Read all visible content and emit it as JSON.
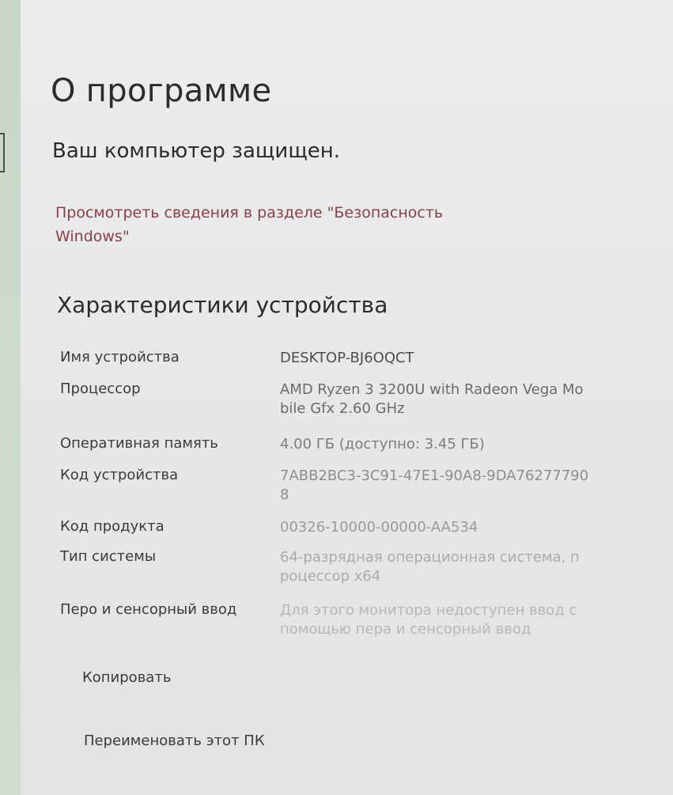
{
  "page": {
    "title": "О программе",
    "status": "Ваш компьютер защищен.",
    "security_link": "Просмотреть сведения в разделе \"Безопасность Windows\""
  },
  "device_specs": {
    "heading": "Характеристики устройства",
    "rows": [
      {
        "label": "Имя устройства",
        "value": "DESKTOP-BJ6OQCT"
      },
      {
        "label": "Процессор",
        "value": "AMD Ryzen 3 3200U with Radeon Vega Mobile Gfx     2.60 GHz"
      },
      {
        "label": "Оперативная память",
        "value": "4.00 ГБ (доступно: 3.45 ГБ)"
      },
      {
        "label": "Код устройства",
        "value": "7ABB2BC3-3C91-47E1-90A8-9DA76277790 8"
      },
      {
        "label": "Код продукта",
        "value": "00326-10000-00000-AA534"
      },
      {
        "label": "Тип системы",
        "value": "64-разрядная операционная система, процессор x64"
      },
      {
        "label": "Перо и сенсорный ввод",
        "value": "Для этого монитора недоступен ввод с помощью пера и сенсорный ввод"
      }
    ],
    "copy_label": "Копировать",
    "rename_label": "Переименовать этот ПК"
  },
  "colors": {
    "link": "#8a3e48",
    "accent_strip": "#c9d6c7"
  }
}
